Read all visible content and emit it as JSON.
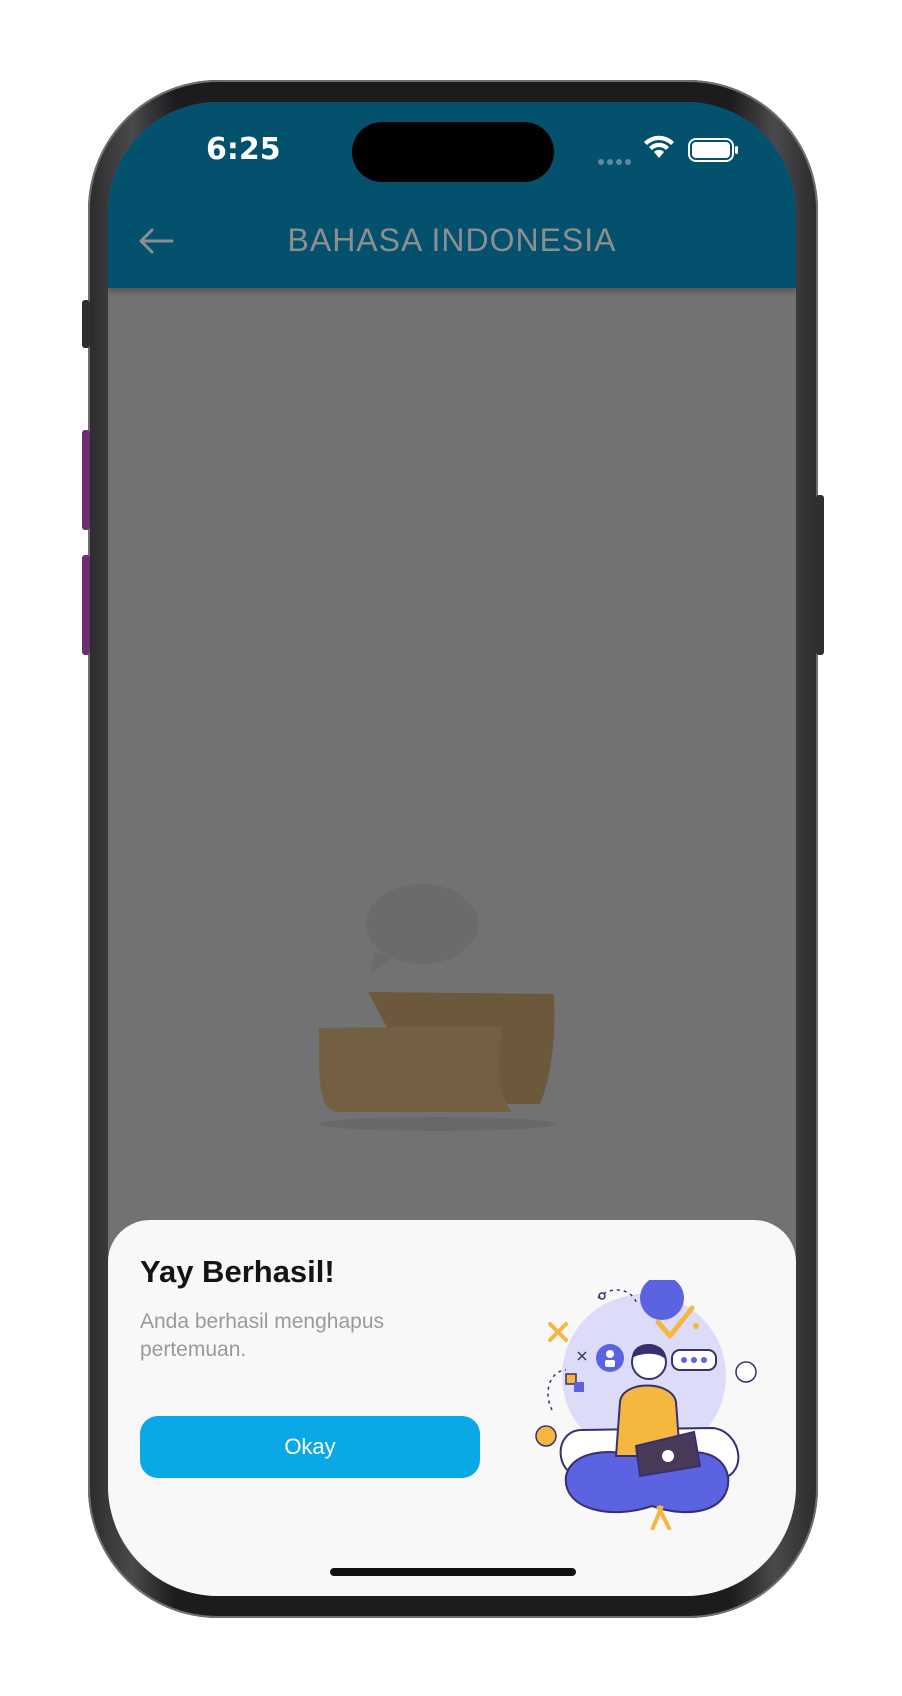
{
  "status_bar": {
    "time": "6:25"
  },
  "header": {
    "title": "BAHASA INDONESIA",
    "back_icon": "arrow-left-icon",
    "background": "#03516c"
  },
  "dialog": {
    "title": "Yay Berhasil!",
    "message": "Anda berhasil menghapus pertemuan.",
    "button_label": "Okay",
    "button_color": "#0aa8e6"
  },
  "colors": {
    "scrim": "#727274",
    "sheet": "#f8f8f9"
  }
}
